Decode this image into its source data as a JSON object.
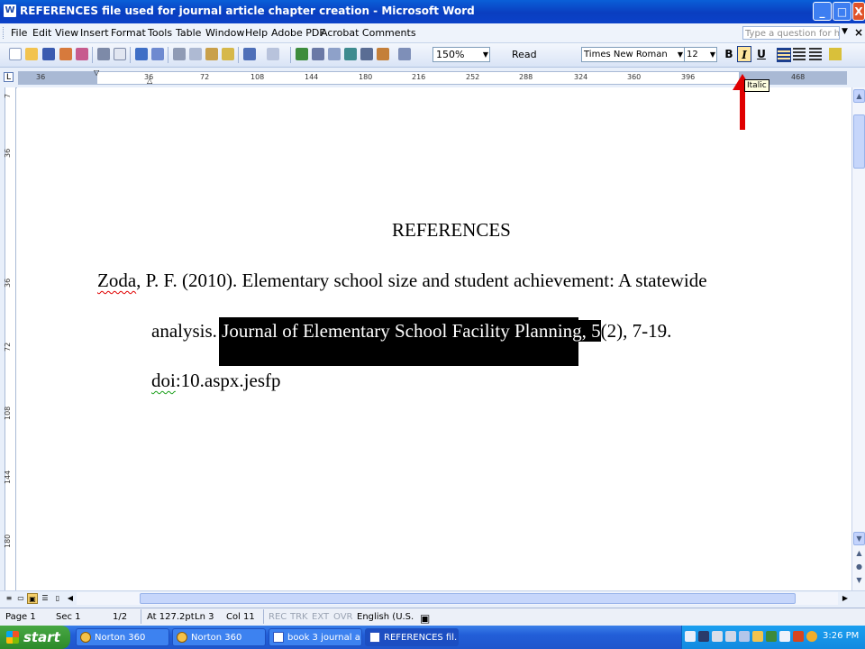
{
  "window": {
    "title": "REFERENCES file used for journal article chapter creation - Microsoft Word",
    "controls": [
      "_",
      "□",
      "X"
    ]
  },
  "menu": {
    "items": [
      "File",
      "Edit",
      "View",
      "Insert",
      "Format",
      "Tools",
      "Table",
      "Window",
      "Help",
      "Adobe PDF",
      "Acrobat Comments"
    ],
    "help_placeholder": "Type a question for help"
  },
  "toolbar": {
    "zoom": "150%",
    "read_label": "Read",
    "font_name": "Times New Roman",
    "font_size": "12",
    "bold": "B",
    "italic": "I",
    "underline": "U",
    "tooltip": "Italic"
  },
  "ruler": {
    "numbers": [
      "36",
      "36",
      "72",
      "108",
      "144",
      "180",
      "216",
      "252",
      "288",
      "324",
      "360",
      "396",
      "468"
    ],
    "vertical_numbers": [
      "7",
      "36",
      "36",
      "72",
      "108",
      "144",
      "180"
    ]
  },
  "document": {
    "heading": "REFERENCES",
    "line1_author": "Zoda",
    "line1_rest": ", P. F. (2010). Elementary school size and student achievement: A statewide",
    "line2_prefix": "analysis. ",
    "line2_selected": "Journal of Elementary School Facility Planning, 5",
    "line2_suffix": "(2), 7-19.",
    "line3_doi": "doi",
    "line3_rest": ":10.aspx.jesfp"
  },
  "status": {
    "page": "Page 1",
    "sec": "Sec 1",
    "pages": "1/2",
    "at": "At 127.2pt",
    "ln": "Ln 3",
    "col": "Col 11",
    "rec": "REC",
    "trk": "TRK",
    "ext": "EXT",
    "ovr": "OVR",
    "language": "English (U.S."
  },
  "taskbar": {
    "start": "start",
    "tasks": [
      "Norton 360",
      "Norton 360",
      "book 3 journal a...",
      "REFERENCES fil..."
    ],
    "clock": "3:26 PM"
  },
  "colors": {
    "annotation_arrow": "#e00000",
    "selection": "#000000",
    "italic_highlight": "#ffe59e"
  }
}
